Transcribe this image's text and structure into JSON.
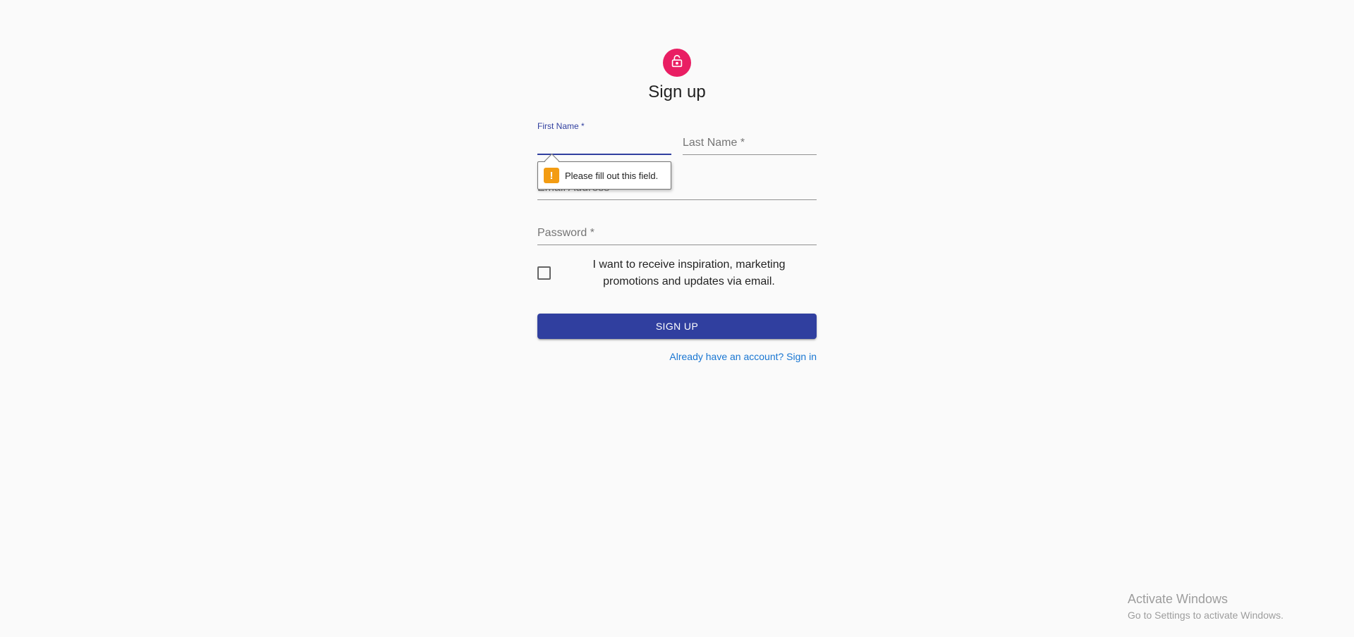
{
  "header": {
    "icon": "lock-icon",
    "title": "Sign up"
  },
  "form": {
    "first_name": {
      "label": "First Name *",
      "value": "",
      "focused": true
    },
    "last_name": {
      "label": "Last Name *",
      "value": ""
    },
    "email": {
      "label": "Email Address *",
      "value": ""
    },
    "password": {
      "label": "Password *",
      "value": ""
    },
    "validation_tooltip": {
      "icon": "warning-icon",
      "message": "Please fill out this field."
    },
    "marketing_checkbox": {
      "checked": false,
      "label": "I want to receive inspiration, marketing promotions and updates via email."
    },
    "submit_label": "SIGN UP",
    "signin_link": "Already have an account? Sign in"
  },
  "watermark": {
    "title": "Activate Windows",
    "subtitle": "Go to Settings to activate Windows."
  },
  "colors": {
    "avatar": "#e91e63",
    "primary": "#303f9f",
    "link": "#1976d2",
    "warning": "#f39c12"
  }
}
